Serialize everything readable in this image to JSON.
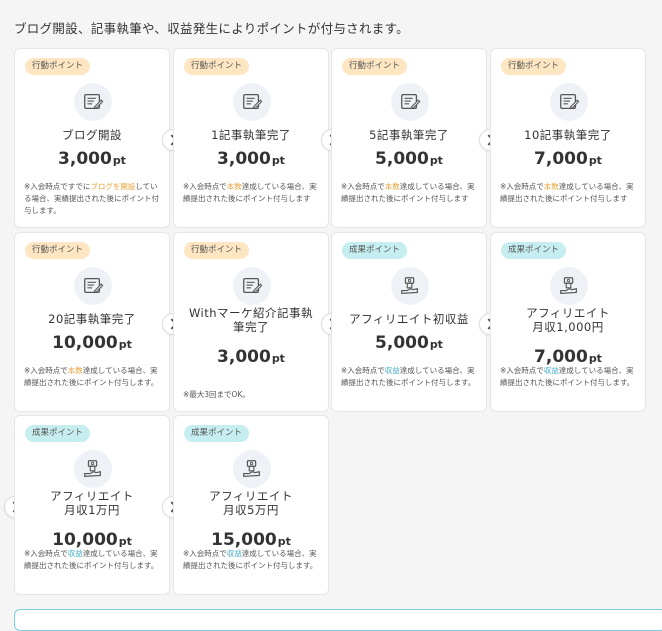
{
  "intro": "ブログ開設、記事執筆や、収益発生によりポイントが付与されます。",
  "badges": {
    "action": "行動ポイント",
    "result": "成果ポイント"
  },
  "unit": "pt",
  "cards": [
    {
      "title": "ブログ開設",
      "points": "3,000",
      "note_a": "※入会時点ですでに",
      "note_hl": "ブログを開設",
      "note_b": "している場合、実績提出された後にポイント付与します。"
    },
    {
      "title": "1記事執筆完了",
      "points": "3,000",
      "note_a": "※入会時点で",
      "note_hl": "本数",
      "note_b": "達成している場合、実績提出された後にポイント付与します"
    },
    {
      "title": "5記事執筆完了",
      "points": "5,000",
      "note_a": "※入会時点で",
      "note_hl": "本数",
      "note_b": "達成している場合、実績提出された後にポイント付与します"
    },
    {
      "title": "10記事執筆完了",
      "points": "7,000",
      "note_a": "※入会時点で",
      "note_hl": "本数",
      "note_b": "達成している場合、実績提出された後にポイント付与します"
    },
    {
      "title": "20記事執筆完了",
      "points": "10,000",
      "note_a": "※入会時点で",
      "note_hl": "本数",
      "note_b": "達成している場合、実績提出された後にポイント付与します。"
    },
    {
      "title_1": "Withマーケ紹介記事執",
      "title_2": "筆完了",
      "points": "3,000",
      "note": "※最大3回までOK。"
    },
    {
      "title": "アフィリエイト初収益",
      "points": "5,000",
      "note_a": "※入会時点で",
      "note_hl": "収益",
      "note_b": "達成している場合、実績提出された後にポイント付与します。"
    },
    {
      "title_1": "アフィリエイト",
      "title_2": "月収1,000円",
      "points": "7,000",
      "note_a": "※入会時点で",
      "note_hl": "収益",
      "note_b": "達成している場合、実績提出された後にポイント付与します。"
    },
    {
      "title_1": "アフィリエイト",
      "title_2": "月収1万円",
      "points": "10,000",
      "note_a": "※入会時点で",
      "note_hl": "収益",
      "note_b": "達成している場合、実績提出された後にポイント付与します。"
    },
    {
      "title_1": "アフィリエイト",
      "title_2": "月収5万円",
      "points": "15,000",
      "note_a": "※入会時点で",
      "note_hl": "収益",
      "note_b": "達成している場合、実績提出された後にポイント付与します。"
    }
  ]
}
